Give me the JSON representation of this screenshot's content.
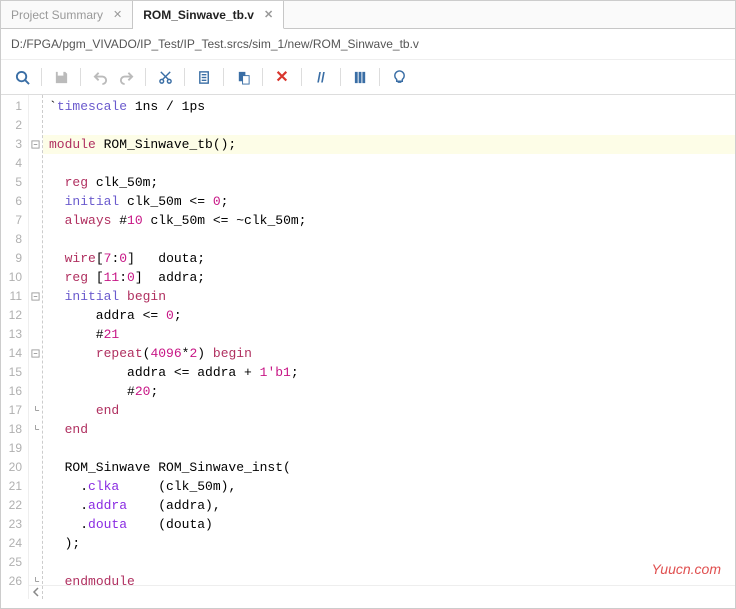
{
  "tabs": [
    {
      "label": "Project Summary",
      "active": false
    },
    {
      "label": "ROM_Sinwave_tb.v",
      "active": true
    }
  ],
  "path": "D:/FPGA/pgm_VIVADO/IP_Test/IP_Test.srcs/sim_1/new/ROM_Sinwave_tb.v",
  "toolbar": {
    "search": "search",
    "save": "save",
    "undo": "undo",
    "redo": "redo",
    "cut": "cut",
    "copy": "copy",
    "paste": "paste",
    "delete": "delete",
    "comment": "//",
    "column": "column",
    "hint": "hint"
  },
  "code": [
    {
      "n": 1,
      "fold": "",
      "hl": false,
      "t": "`<k1>timescale</k1> 1ns / 1ps"
    },
    {
      "n": 2,
      "fold": "",
      "hl": false,
      "t": ""
    },
    {
      "n": 3,
      "fold": "o",
      "hl": true,
      "t": "<k2>module</k2> ROM_Sinwave_tb();"
    },
    {
      "n": 4,
      "fold": "",
      "hl": false,
      "t": ""
    },
    {
      "n": 5,
      "fold": "",
      "hl": false,
      "t": "  <k2>reg</k2> clk_50m;"
    },
    {
      "n": 6,
      "fold": "",
      "hl": false,
      "t": "  <k1>initial</k1> clk_50m <= <n>0</n>;"
    },
    {
      "n": 7,
      "fold": "",
      "hl": false,
      "t": "  <k2>always</k2> #<n>10</n> clk_50m <= ~clk_50m;"
    },
    {
      "n": 8,
      "fold": "",
      "hl": false,
      "t": ""
    },
    {
      "n": 9,
      "fold": "",
      "hl": false,
      "t": "  <k2>wire</k2>[<n>7</n>:<n>0</n>]   douta;"
    },
    {
      "n": 10,
      "fold": "",
      "hl": false,
      "t": "  <k2>reg</k2> [<n>11</n>:<n>0</n>]  addra;"
    },
    {
      "n": 11,
      "fold": "o",
      "hl": false,
      "t": "  <k1>initial</k1> <k2>begin</k2>"
    },
    {
      "n": 12,
      "fold": "",
      "hl": false,
      "t": "      addra <= <n>0</n>;"
    },
    {
      "n": 13,
      "fold": "",
      "hl": false,
      "t": "      #<n>21</n>"
    },
    {
      "n": 14,
      "fold": "o",
      "hl": false,
      "t": "      <k2>repeat</k2>(<n>4096</n>*<n>2</n>) <k2>begin</k2>"
    },
    {
      "n": 15,
      "fold": "",
      "hl": false,
      "t": "          addra <= addra + <n>1'b1</n>;"
    },
    {
      "n": 16,
      "fold": "",
      "hl": false,
      "t": "          #<n>20</n>;"
    },
    {
      "n": 17,
      "fold": "c",
      "hl": false,
      "t": "      <k2>end</k2>"
    },
    {
      "n": 18,
      "fold": "c",
      "hl": false,
      "t": "  <k2>end</k2>"
    },
    {
      "n": 19,
      "fold": "",
      "hl": false,
      "t": ""
    },
    {
      "n": 20,
      "fold": "",
      "hl": false,
      "t": "  ROM_Sinwave ROM_Sinwave_inst("
    },
    {
      "n": 21,
      "fold": "",
      "hl": false,
      "t": "    .<k3>clka</k3>     (clk_50m),"
    },
    {
      "n": 22,
      "fold": "",
      "hl": false,
      "t": "    .<k3>addra</k3>    (addra),"
    },
    {
      "n": 23,
      "fold": "",
      "hl": false,
      "t": "    .<k3>douta</k3>    (douta)"
    },
    {
      "n": 24,
      "fold": "",
      "hl": false,
      "t": "  );"
    },
    {
      "n": 25,
      "fold": "",
      "hl": false,
      "t": ""
    },
    {
      "n": 26,
      "fold": "c",
      "hl": false,
      "t": "  <k2>endmodule</k2>"
    }
  ],
  "watermark": "Yuucn.com"
}
